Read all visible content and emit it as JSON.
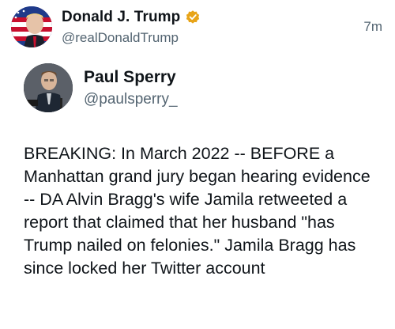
{
  "post": {
    "author_name": "Donald J. Trump",
    "author_handle": "@realDonaldTrump",
    "timestamp": "7m",
    "verified_color": "#e8a418"
  },
  "quoted_post": {
    "author_name": "Paul Sperry",
    "author_handle": "@paulsperry_",
    "body": "BREAKING: In March 2022 -- BEFORE a Manhattan grand jury began hearing evidence -- DA Alvin Bragg's wife Jamila retweeted a report that claimed that her husband \"has Trump nailed on felonies.\" Jamila Bragg has since locked her Twitter account"
  },
  "icons": {
    "verified": "verified-badge-icon"
  }
}
